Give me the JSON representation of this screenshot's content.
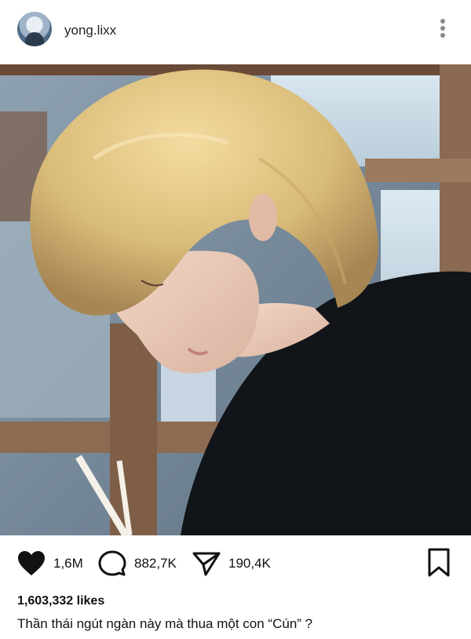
{
  "header": {
    "username": "yong.lixx",
    "avatar_icon": "avatar-image",
    "more_icon": "more-vertical-icon"
  },
  "post": {
    "photo_description_icon": "post-photo"
  },
  "actions": {
    "like_count": "1,6M",
    "comment_count": "882,7K",
    "share_count": "190,4K",
    "icons": [
      "heart-icon",
      "comment-icon",
      "send-icon",
      "bookmark-icon"
    ]
  },
  "likes_text": "1,603,332 likes",
  "caption": "Thần thái ngút ngàn này mà thua một con “Cún” ?",
  "colors": {
    "text": "#111111",
    "muted": "#8a8a8a",
    "background": "#ffffff"
  }
}
